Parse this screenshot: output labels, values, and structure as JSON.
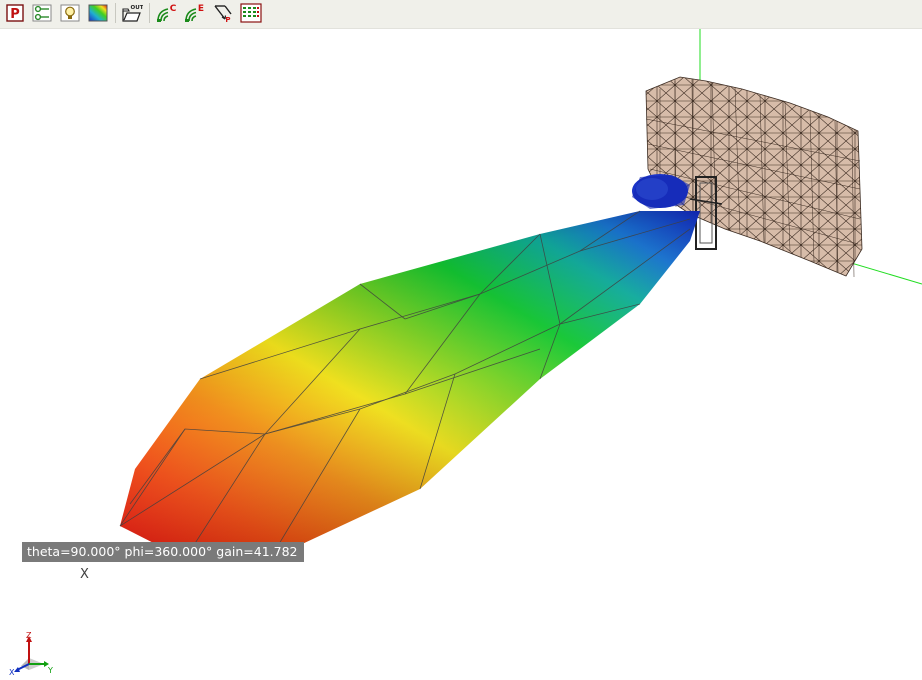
{
  "toolbar": {
    "buttons": [
      {
        "name": "p-icon",
        "label": "P"
      },
      {
        "name": "network-icon"
      },
      {
        "name": "lightbulb-icon"
      },
      {
        "name": "colormap-icon"
      },
      {
        "name": "open-out-icon",
        "label": "OUT"
      },
      {
        "name": "far-field-c-icon",
        "label": "C"
      },
      {
        "name": "far-field-e-icon",
        "label": "E"
      },
      {
        "name": "poynting-icon",
        "label": "P"
      },
      {
        "name": "results-table-icon"
      }
    ]
  },
  "colors": {
    "toolbar_bg": "#f0f0ea",
    "viewport_bg": "#ffffff",
    "reflector_mesh": "#d7bca9",
    "axis_green": "#22dd22",
    "readout_bg": "#7a7a7a",
    "gain_max": "#e81010",
    "gain_min": "#1a2ec8"
  },
  "readout": {
    "theta": "theta=90.000°",
    "phi": "phi=360.000°",
    "gain": "gain=41.782"
  },
  "axis_label": "X",
  "triad": {
    "x": "X",
    "y": "Y",
    "z": "Z"
  }
}
